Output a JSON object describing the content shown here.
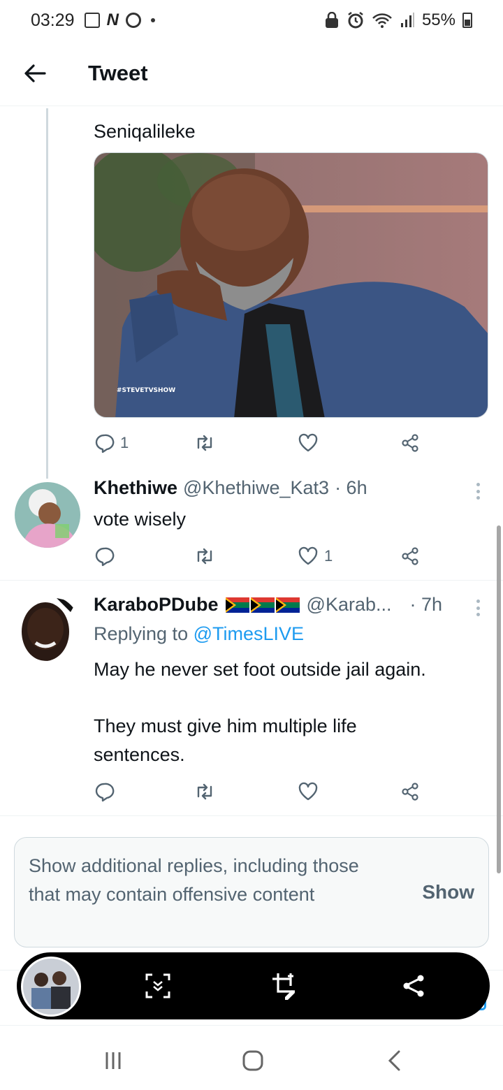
{
  "status_bar": {
    "time": "03:29",
    "battery": "55%",
    "left_icons": [
      "gallery-icon",
      "n-app-icon",
      "chrome-icon",
      "dot"
    ],
    "right_icons": [
      "lock-app-icon",
      "alarm-icon",
      "wifi-icon",
      "signal-icon",
      "battery-icon"
    ]
  },
  "header": {
    "title": "Tweet"
  },
  "tweet1": {
    "text": "Seniqalileke",
    "image_watermark": "#STEVETVSHOW",
    "reply_count": "1",
    "retweet_count": "",
    "like_count": ""
  },
  "tweet2": {
    "name": "Khethiwe",
    "handle": "@Khethiwe_Kat3",
    "time": "· 6h",
    "text": "vote wisely",
    "reply_count": "",
    "retweet_count": "",
    "like_count": "1"
  },
  "tweet3": {
    "name": "KaraboPDube",
    "handle": "@Karab...",
    "time": "· 7h",
    "replying_prefix": "Replying to ",
    "replying_to": "@TimesLIVE",
    "text_line1": "May he never set foot outside jail again.",
    "text_line2": "They must give him multiple life",
    "text_line3": "sentences.",
    "reply_count": "",
    "retweet_count": "",
    "like_count": ""
  },
  "show_more": {
    "text": "Show additional replies, including those that may contain offensive content",
    "button": "Show"
  },
  "colors": {
    "link": "#1d9bf0",
    "secondary": "#536471",
    "toolbar_bg": "#000000"
  }
}
